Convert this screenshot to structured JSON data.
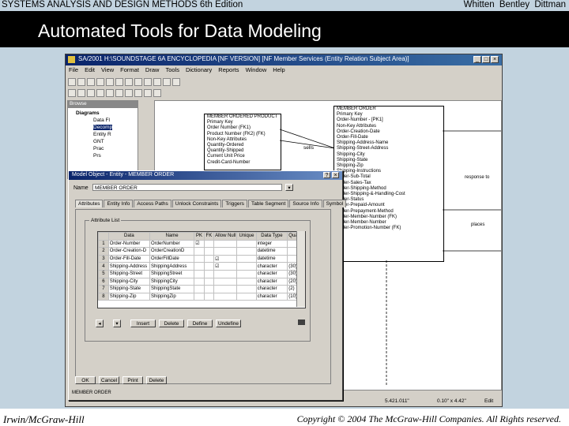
{
  "slide": {
    "book_title": "SYSTEMS ANALYSIS AND DESIGN METHODS  6th Edition",
    "authors": "Whitten  Bentley  Dittman",
    "title": "Automated Tools for Data Modeling",
    "publisher": "Irwin/McGraw-Hill",
    "copyright": "Copyright © 2004 The McGraw-Hill Companies. All Rights reserved."
  },
  "app": {
    "title": "SA/2001  H:\\SOUNDSTAGE 6A ENCYCLOPEDIA  [NF VERSION] [NF Member Services (Entity Relation Subject Area)]",
    "menu": [
      "File",
      "Edit",
      "View",
      "Format",
      "Draw",
      "Tools",
      "Dictionary",
      "Reports",
      "Window",
      "Help"
    ],
    "browser": {
      "title": "Browse",
      "items": [
        "Diagrams",
        "Data Fl",
        "Decomp",
        "Entity R",
        "GNT",
        "Prac",
        "Prs"
      ]
    },
    "entity_left": {
      "rows": [
        "MEMBER ORDERED PRODUCT",
        "Primary Key",
        "Order Number (FK1)",
        "Product Number (FK2) (FK)",
        "Non-Key Attributes",
        "Quantity-Ordered",
        "Quantity-Shipped",
        "Current Unit Price",
        "Credit-Card-Number"
      ]
    },
    "entity_right": {
      "rows": [
        "MEMBER ORDER",
        "Primary Key",
        "Order-Number - [PK1]",
        "Non-Key Attributes",
        "Order-Creation-Date",
        "Order-Fill-Date",
        "Shipping-Address-Name",
        "Shipping-Street-Address",
        "Shipping-City",
        "Shipping-State",
        "Shipping-Zip",
        "Shipping-Instructions",
        "Order-Sub-Total",
        "Order-Sales-Tax",
        "Order-Shipping-Method",
        "Order-Shipping-&-Handling-Cost",
        "Order-Status",
        "Order-Prepaid-Amount",
        "Order-Prepayment-Method",
        "Order-Member-Number (FK)",
        "Order-Member-Number",
        "Order-Promotion-Number (FK)"
      ]
    },
    "label_sells": "sells",
    "label_response": "response to",
    "label_places": "places",
    "status": "5.421.011\"",
    "status_zoom": "0.10\" x 4.42\"",
    "status_mode": "Edit"
  },
  "dialog": {
    "title": "Model Object - Entity - MEMBER ORDER",
    "name_label": "Name",
    "name_value": "MEMBER  ORDER",
    "tabs": [
      "Attributes",
      "Entity Info",
      "Access Paths",
      "Unlock Constraints",
      "Triggers",
      "Table Segment",
      "Source Info",
      "Symbol"
    ],
    "group_label": "Attribute List",
    "columns": [
      "",
      "Data",
      "Name",
      "PK",
      "FK",
      "Allow Null",
      "Unique",
      "Data Type",
      "Quality"
    ],
    "rows": [
      [
        "1",
        "Order-Number",
        "OrderNumber",
        "☑",
        "",
        "",
        "",
        "integer",
        ""
      ],
      [
        "2",
        "Order-Creation-D",
        "OrderCreationD",
        "",
        "",
        "",
        "",
        "datetime",
        ""
      ],
      [
        "3",
        "Order-Fill-Date",
        "OrderFillDate",
        "",
        "",
        "☑",
        "",
        "datetime",
        ""
      ],
      [
        "4",
        "Shipping-Address",
        "ShippingAddress",
        "",
        "",
        "☑",
        "",
        "character",
        "(30)"
      ],
      [
        "5",
        "Shipping-Street",
        "ShippingStreet",
        "",
        "",
        "",
        "",
        "character",
        "(30)"
      ],
      [
        "6",
        "Shipping-City",
        "ShippingCity",
        "",
        "",
        "",
        "",
        "character",
        "(20)"
      ],
      [
        "7",
        "Shipping-State",
        "ShippingState",
        "",
        "",
        "",
        "",
        "character",
        "(2)"
      ],
      [
        "8",
        "Shipping-Zip",
        "ShippingZip",
        "",
        "",
        "",
        "",
        "character",
        "(10)"
      ]
    ],
    "row_buttons": [
      "Insert",
      "Delete",
      "Define",
      "Undefine"
    ],
    "bottom_buttons": [
      "OK",
      "Cancel",
      "Print",
      "Delete"
    ]
  }
}
